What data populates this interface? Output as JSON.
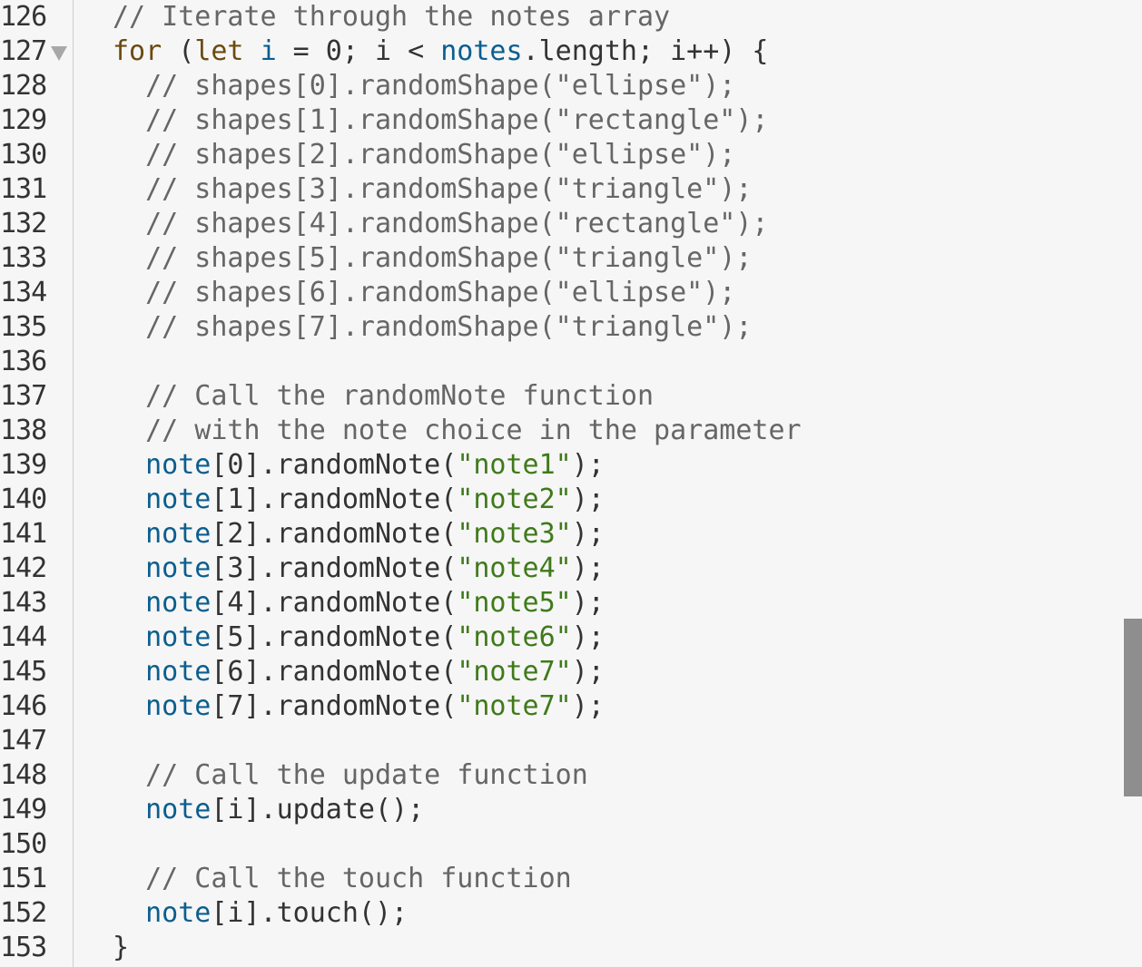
{
  "editor": {
    "lines": [
      {
        "n": "126",
        "tokens": [
          {
            "t": "// Iterate through the notes array",
            "c": "comment"
          }
        ]
      },
      {
        "n": "127",
        "fold": true,
        "tokens": [
          {
            "t": "for",
            "c": "kw"
          },
          {
            "t": " (",
            "c": ""
          },
          {
            "t": "let",
            "c": "kw"
          },
          {
            "t": " ",
            "c": ""
          },
          {
            "t": "i",
            "c": "var"
          },
          {
            "t": " = 0; i < ",
            "c": ""
          },
          {
            "t": "notes",
            "c": "var"
          },
          {
            "t": ".length; i++) {",
            "c": ""
          }
        ]
      },
      {
        "n": "128",
        "tokens": [
          {
            "t": "  // shapes[0].randomShape(\"ellipse\");",
            "c": "comment"
          }
        ]
      },
      {
        "n": "129",
        "tokens": [
          {
            "t": "  // shapes[1].randomShape(\"rectangle\");",
            "c": "comment"
          }
        ]
      },
      {
        "n": "130",
        "tokens": [
          {
            "t": "  // shapes[2].randomShape(\"ellipse\");",
            "c": "comment"
          }
        ]
      },
      {
        "n": "131",
        "tokens": [
          {
            "t": "  // shapes[3].randomShape(\"triangle\");",
            "c": "comment"
          }
        ]
      },
      {
        "n": "132",
        "tokens": [
          {
            "t": "  // shapes[4].randomShape(\"rectangle\");",
            "c": "comment"
          }
        ]
      },
      {
        "n": "133",
        "tokens": [
          {
            "t": "  // shapes[5].randomShape(\"triangle\");",
            "c": "comment"
          }
        ]
      },
      {
        "n": "134",
        "tokens": [
          {
            "t": "  // shapes[6].randomShape(\"ellipse\");",
            "c": "comment"
          }
        ]
      },
      {
        "n": "135",
        "tokens": [
          {
            "t": "  // shapes[7].randomShape(\"triangle\");",
            "c": "comment"
          }
        ]
      },
      {
        "n": "136",
        "tokens": []
      },
      {
        "n": "137",
        "tokens": [
          {
            "t": "  // Call the randomNote function",
            "c": "comment"
          }
        ]
      },
      {
        "n": "138",
        "tokens": [
          {
            "t": "  // with the note choice in the parameter",
            "c": "comment"
          }
        ]
      },
      {
        "n": "139",
        "tokens": [
          {
            "t": "  ",
            "c": ""
          },
          {
            "t": "note",
            "c": "var"
          },
          {
            "t": "[0].randomNote(",
            "c": ""
          },
          {
            "t": "\"note1\"",
            "c": "str"
          },
          {
            "t": ");",
            "c": ""
          }
        ]
      },
      {
        "n": "140",
        "tokens": [
          {
            "t": "  ",
            "c": ""
          },
          {
            "t": "note",
            "c": "var"
          },
          {
            "t": "[1].randomNote(",
            "c": ""
          },
          {
            "t": "\"note2\"",
            "c": "str"
          },
          {
            "t": ");",
            "c": ""
          }
        ]
      },
      {
        "n": "141",
        "tokens": [
          {
            "t": "  ",
            "c": ""
          },
          {
            "t": "note",
            "c": "var"
          },
          {
            "t": "[2].randomNote(",
            "c": ""
          },
          {
            "t": "\"note3\"",
            "c": "str"
          },
          {
            "t": ");",
            "c": ""
          }
        ]
      },
      {
        "n": "142",
        "tokens": [
          {
            "t": "  ",
            "c": ""
          },
          {
            "t": "note",
            "c": "var"
          },
          {
            "t": "[3].randomNote(",
            "c": ""
          },
          {
            "t": "\"note4\"",
            "c": "str"
          },
          {
            "t": ");",
            "c": ""
          }
        ]
      },
      {
        "n": "143",
        "tokens": [
          {
            "t": "  ",
            "c": ""
          },
          {
            "t": "note",
            "c": "var"
          },
          {
            "t": "[4].randomNote(",
            "c": ""
          },
          {
            "t": "\"note5\"",
            "c": "str"
          },
          {
            "t": ");",
            "c": ""
          }
        ]
      },
      {
        "n": "144",
        "tokens": [
          {
            "t": "  ",
            "c": ""
          },
          {
            "t": "note",
            "c": "var"
          },
          {
            "t": "[5].randomNote(",
            "c": ""
          },
          {
            "t": "\"note6\"",
            "c": "str"
          },
          {
            "t": ");",
            "c": ""
          }
        ]
      },
      {
        "n": "145",
        "tokens": [
          {
            "t": "  ",
            "c": ""
          },
          {
            "t": "note",
            "c": "var"
          },
          {
            "t": "[6].randomNote(",
            "c": ""
          },
          {
            "t": "\"note7\"",
            "c": "str"
          },
          {
            "t": ");",
            "c": ""
          }
        ]
      },
      {
        "n": "146",
        "tokens": [
          {
            "t": "  ",
            "c": ""
          },
          {
            "t": "note",
            "c": "var"
          },
          {
            "t": "[7].randomNote(",
            "c": ""
          },
          {
            "t": "\"note7\"",
            "c": "str"
          },
          {
            "t": ");",
            "c": ""
          }
        ]
      },
      {
        "n": "147",
        "tokens": []
      },
      {
        "n": "148",
        "tokens": [
          {
            "t": "  // Call the update function",
            "c": "comment"
          }
        ]
      },
      {
        "n": "149",
        "tokens": [
          {
            "t": "  ",
            "c": ""
          },
          {
            "t": "note",
            "c": "var"
          },
          {
            "t": "[i].update();",
            "c": ""
          }
        ]
      },
      {
        "n": "150",
        "tokens": []
      },
      {
        "n": "151",
        "tokens": [
          {
            "t": "  // Call the touch function",
            "c": "comment"
          }
        ]
      },
      {
        "n": "152",
        "tokens": [
          {
            "t": "  ",
            "c": ""
          },
          {
            "t": "note",
            "c": "var"
          },
          {
            "t": "[i].touch();",
            "c": ""
          }
        ]
      },
      {
        "n": "153",
        "tokens": [
          {
            "t": "}",
            "c": ""
          }
        ]
      }
    ]
  },
  "colors": {
    "background": "#f6f6f6",
    "line_number": "#333333",
    "comment": "#666666",
    "keyword": "#6b4a10",
    "variable": "#0b5e8f",
    "string": "#3f7a1a",
    "scrollbar": "#8e8e8e"
  },
  "icons": {
    "fold_marker": "fold-triangle-icon"
  }
}
